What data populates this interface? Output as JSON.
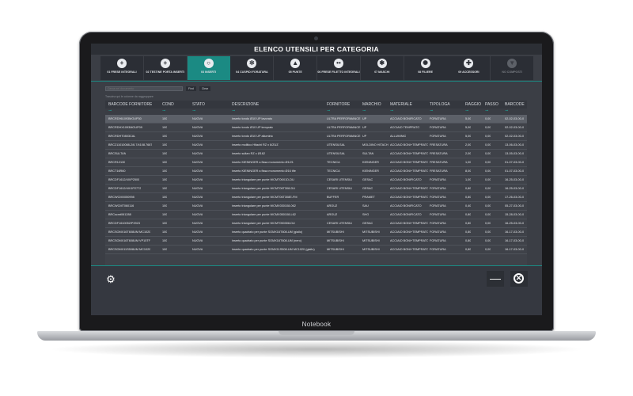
{
  "app_title": "ELENCO  UTENSILI PER CATEGORIA",
  "brand_label": "Notebook",
  "categories": [
    {
      "label": "01 FRESE INTEGRALI",
      "icon": "plus-circle-icon",
      "glyph": "+"
    },
    {
      "label": "02 TESTINE PORTA INSERTI",
      "icon": "plus-circle-icon",
      "glyph": "+"
    },
    {
      "label": "03 INSERTI",
      "icon": "ring-icon",
      "glyph": "○"
    },
    {
      "label": "04 CUSPIDI FORATURA",
      "icon": "hexagon-bolt-icon",
      "glyph": "✲"
    },
    {
      "label": "05 PUNTE",
      "icon": "triangle-icon",
      "glyph": "▲"
    },
    {
      "label": "06 FRESE FILETTO INTEGRALI",
      "icon": "dots-icon",
      "glyph": "••"
    },
    {
      "label": "07 MASCHI",
      "icon": "star-gear-icon",
      "glyph": "✱"
    },
    {
      "label": "08 FILIERE",
      "icon": "gear-wheel-icon",
      "glyph": "✺"
    },
    {
      "label": "09 ACCESSORI",
      "icon": "crosshair-icon",
      "glyph": "✚"
    },
    {
      "label": "NO COMPOSTI",
      "icon": "funnel-icon",
      "glyph": "▼"
    }
  ],
  "search": {
    "placeholder": "Cerca nel documento",
    "find_label": "Find",
    "clear_label": "Clear"
  },
  "hint_text": "Trascina qui le colonne da raggruppare",
  "columns": [
    "BARCODE FORNITORE",
    "COND",
    "STATO",
    "DESCRIZIONE",
    "FORNITORE",
    "MARCHIO",
    "MATERIALE",
    "TIPOLOGA",
    "RAGGIO",
    "PASSO",
    "BARCODE"
  ],
  "rows": [
    [
      "BRCRD961093MOUP30",
      "100",
      "NUOVA",
      "inserto tondo Ø10 UP lavorato",
      "ULTRA PERFORMANCE",
      "UP",
      "ACCIAIO BONIFICATO",
      "FORATURA",
      "5,00",
      "0,00",
      "02-02-03-00-0"
    ],
    [
      "BRCRDHX1093MOUP09",
      "100",
      "NUOVA",
      "inserto tondo Ø10 UP temprato",
      "ULTRA PERFORMANCE",
      "UP",
      "ACCIAIO TEMPRATO",
      "FORATURA",
      "5,00",
      "0,00",
      "02-02-03-00-0"
    ],
    [
      "BRCRDHT0803CAL",
      "100",
      "NUOVA",
      "inserto tondo Ø10 UP alluminio",
      "ULTRA PERFORMANCE",
      "UP",
      "ALLUMINIO",
      "FORATURA",
      "5,00",
      "0,00",
      "02-02-03-00-0"
    ],
    [
      "BRC211010088-2/6.7/4108.7687",
      "100",
      "NUOVA",
      "inserto molitico Hitachi RZ x 8/ZUZ",
      "UTENSILSAL",
      "MOLDINO HITACHI",
      "ACCIAIO BONI+TEMPRATO",
      "FRESATURA",
      "2,00",
      "0,00",
      "13-06-03-00-0"
    ],
    [
      "BRCSULTAN",
      "100",
      "NUOVA",
      "inserto sultan RZ x Ø162",
      "UTENSILSAL",
      "SULTAN",
      "ACCIAIO BONI+TEMPRATO",
      "FRESATURA",
      "2,00",
      "0,00",
      "13-05-03-00-0"
    ],
    [
      "BRCR12130",
      "100",
      "NUOVA",
      "inserto KIENINGER a fissa monomento Ø12/1",
      "TECNICA",
      "KIENINGER",
      "ACCIAIO BONI+TEMPRATO",
      "FRESATURA",
      "1,00",
      "0,00",
      "01-07-03-00-0"
    ],
    [
      "BRCT16R60",
      "100",
      "NUOVA",
      "inserto KIENINGER a fissa monomento Ø16 tife",
      "TECNICA",
      "KIENINGER",
      "ACCIAIO BONI+TEMPRATO",
      "FRESATURA",
      "8,00",
      "0,00",
      "01-07-03-00-0"
    ],
    [
      "BRCDF1612/4X/P2500",
      "100",
      "NUOVA",
      "inserto triangolare per punte WCMT06X1D-DU",
      "CESARI UTENSILI",
      "GESAC",
      "ACCIAIO BONIFICATO",
      "FORATURA",
      "1,00",
      "0,00",
      "16-25-03-00-0"
    ],
    [
      "BRCDF1612/4X/1P2772",
      "100",
      "NUOVA",
      "inserto triangolare per punte WCMT06T308-DU",
      "CESARI UTENSILI",
      "GESAC",
      "ACCIAIO BONI+TEMPRATO",
      "FORATURA",
      "0,80",
      "0,00",
      "16-25-03-00-0"
    ],
    [
      "BRCWCMX050998",
      "100",
      "NUOVA",
      "inserto triangolare per punte WCMT06T308E-FM",
      "BUFFER",
      "PRAMET",
      "ACCIAIO BONI+TEMPRATO",
      "FORATURA",
      "0,80",
      "0,00",
      "17-26-03-00-0"
    ],
    [
      "BRCWCMT060116",
      "100",
      "NUOVA",
      "inserto triangolare per punte WCMX030108-062",
      "ARGUZ",
      "SAU",
      "ACCIAIO BONIFICATO",
      "FORATURA",
      "0,40",
      "0,00",
      "05-27-03-00-0"
    ],
    [
      "BRCscmt061288",
      "100",
      "NUOVA",
      "inserto triangolare per punte WCMX050108-L62",
      "ARGUZ",
      "SHG",
      "ACCIAIO BONIFICATO",
      "FORATURA",
      "0,80",
      "0,00",
      "15-28-03-00-0"
    ],
    [
      "BRCDF1610052/P2923",
      "100",
      "NUOVA",
      "inserto triangolare per punte WCMT050308-DU",
      "CESARI UTENSILI",
      "GESAC",
      "ACCIAIO BONI+TEMPRATO",
      "FORATURA",
      "0,80",
      "0,00",
      "16-25-03-00-0"
    ],
    [
      "BRCSOMX16T608UM  MC1020",
      "100",
      "NUOVA",
      "inserto quadrato per punte SOMX16T608-UM (giallo)",
      "MITSUBISHI",
      "MITSUBISHI",
      "ACCIAIO BONI+TEMPRATO",
      "FORATURA",
      "0,80",
      "0,00",
      "16-17-03-00-0"
    ],
    [
      "BRCSOMX16T608UM  VP15TF",
      "100",
      "NUOVA",
      "inserto quadrato per punte SOMX16T608-UM (nero)",
      "MITSUBISHI",
      "MITSUBISHI",
      "ACCIAIO BONI+TEMPRATO",
      "FORATURA",
      "0,80",
      "0,00",
      "16-17-03-00-0"
    ],
    [
      "BRCSOMX11S508UM  MC1020",
      "100",
      "NUOVA",
      "inserto quadrato per punte SOMX11S508-UM MC1020 (giallo)",
      "MITSUBISHI",
      "MITSUBISHI",
      "ACCIAIO BONI+TEMPRATO",
      "FORATURA",
      "0,80",
      "0,00",
      "16-17-03-00-0"
    ]
  ],
  "colors": {
    "accent": "#1b8a83",
    "panel": "#3b3e45",
    "header": "#2c2f35"
  }
}
